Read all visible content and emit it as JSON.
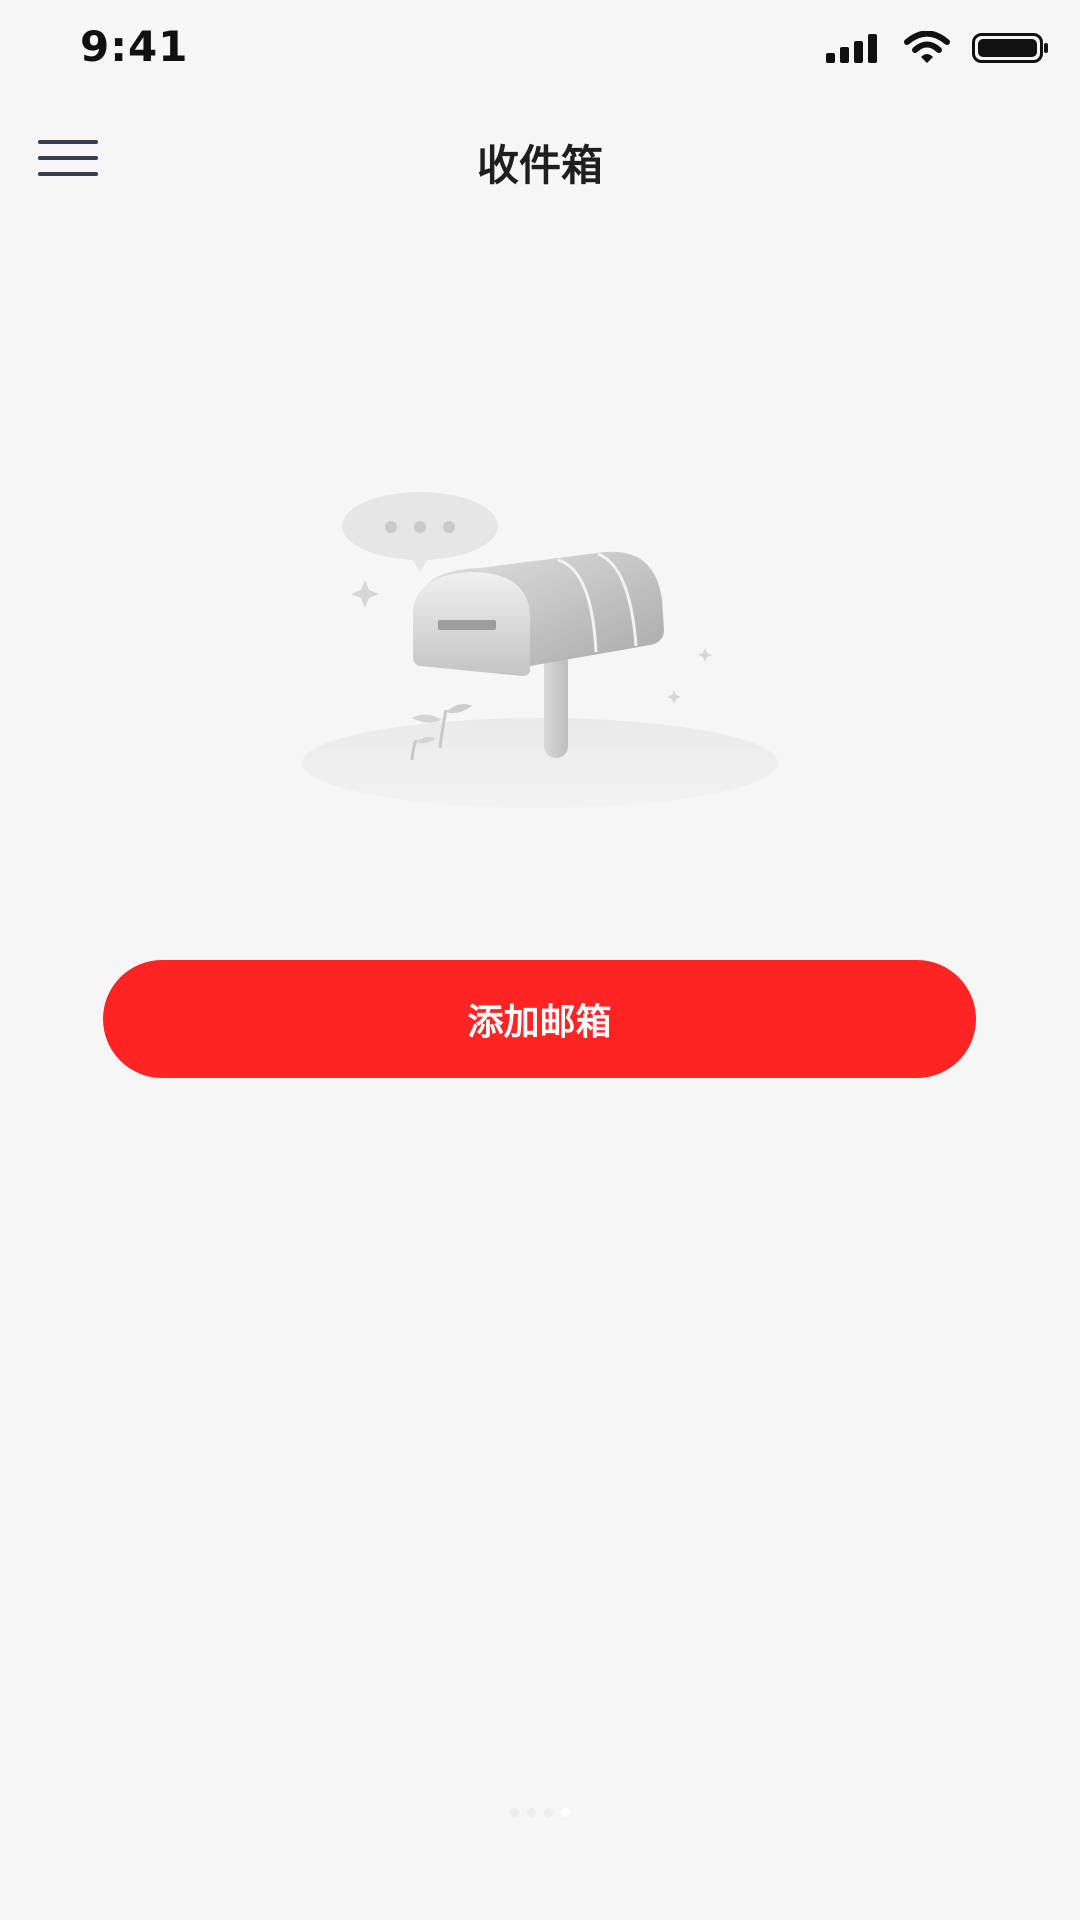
{
  "status_bar": {
    "time": "9:41",
    "icons": [
      "cellular-signal-icon",
      "wifi-icon",
      "battery-icon"
    ]
  },
  "nav_bar": {
    "menu_icon": "hamburger-menu-icon",
    "title": "收件箱"
  },
  "empty_state": {
    "illustration": "empty-mailbox-illustration"
  },
  "actions": {
    "add_mailbox_label": "添加邮箱"
  },
  "pager": {
    "count": 4,
    "active_index": 3
  },
  "colors": {
    "background": "#f6f6f6",
    "primary": "#ff2424",
    "title_text": "#1f1f1f"
  }
}
